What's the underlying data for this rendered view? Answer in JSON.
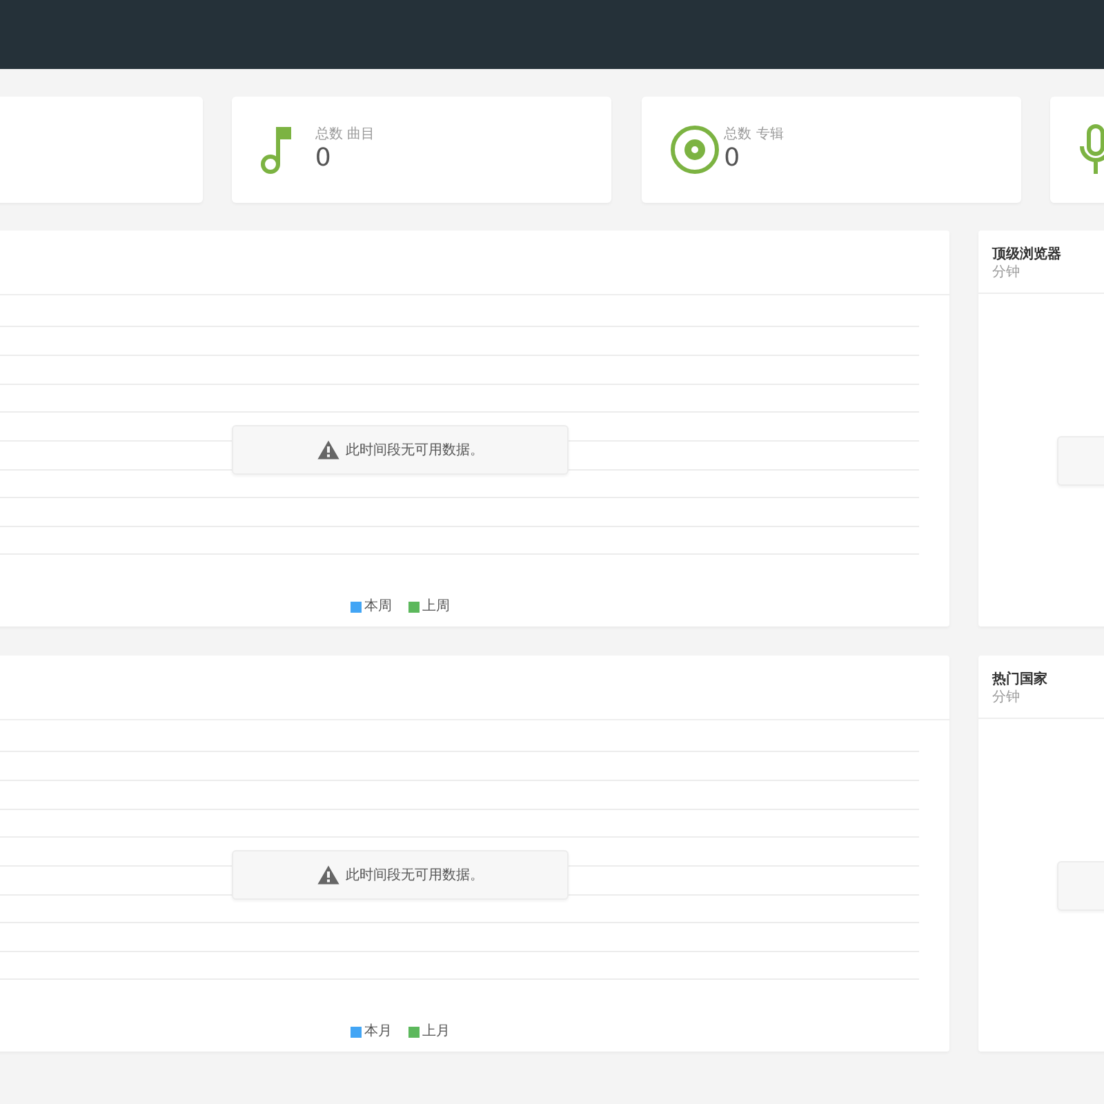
{
  "stat_cards": [
    {
      "kind": "song",
      "label": "总数 曲目",
      "value": "0"
    },
    {
      "kind": "album",
      "label": "总数 专辑",
      "value": "0"
    },
    {
      "kind": "mic"
    }
  ],
  "rows": [
    {
      "chart": {
        "notice": "此时间段无可用数据。",
        "legend": [
          {
            "label": "本周",
            "color": "#42a5f5"
          },
          {
            "label": "上周",
            "color": "#5cb85c"
          }
        ]
      },
      "side_panel": {
        "title": "顶级浏览器",
        "subtitle": "分钟"
      }
    },
    {
      "chart": {
        "notice": "此时间段无可用数据。",
        "legend": [
          {
            "label": "本月",
            "color": "#42a5f5"
          },
          {
            "label": "上月",
            "color": "#5cb85c"
          }
        ]
      },
      "side_panel": {
        "title": "热门国家",
        "subtitle": "分钟"
      }
    }
  ]
}
